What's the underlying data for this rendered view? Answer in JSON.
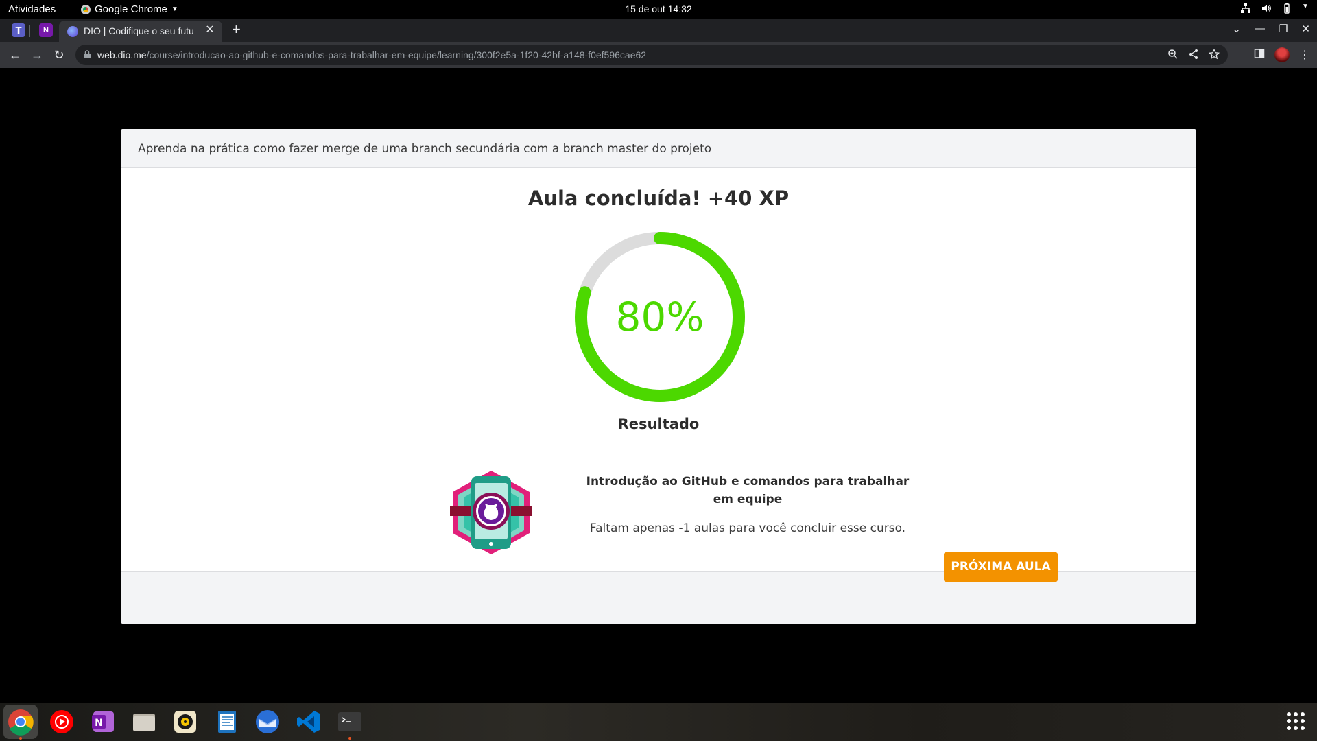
{
  "topbar": {
    "activities": "Atividades",
    "app_name": "Google Chrome",
    "clock": "15 de out  14:32"
  },
  "tabs": {
    "active_title": "DIO | Codifique o seu futu",
    "pinned_onenote_letter": "N"
  },
  "toolbar": {
    "url_host": "web.dio.me",
    "url_path": "/course/introducao-ao-github-e-comandos-para-trabalhar-em-equipe/learning/300f2e5a-1f20-42bf-a148-f0ef596cae62"
  },
  "modal": {
    "header": "Aprenda na prática como fazer merge de uma branch secundária com a branch master do projeto",
    "completion_title": "Aula concluída! +40 XP",
    "progress_text": "80%",
    "progress_value": 0.8,
    "result_label": "Resultado",
    "course_title": "Introdução ao GitHub e comandos para trabalhar em equipe",
    "remaining_text": "Faltam apenas -1 aulas para você concluir esse curso.",
    "next_button": "PRÓXIMA AULA"
  },
  "colors": {
    "progress": "#4cd800",
    "progress_track": "#dcdcdc",
    "accent_button": "#f39200"
  },
  "dock": {
    "apps": [
      "chrome-icon",
      "youtube-music-icon",
      "onenote-icon",
      "files-icon",
      "rhythmbox-icon",
      "text-editor-icon",
      "thunderbird-icon",
      "vscode-icon",
      "terminal-icon"
    ]
  }
}
